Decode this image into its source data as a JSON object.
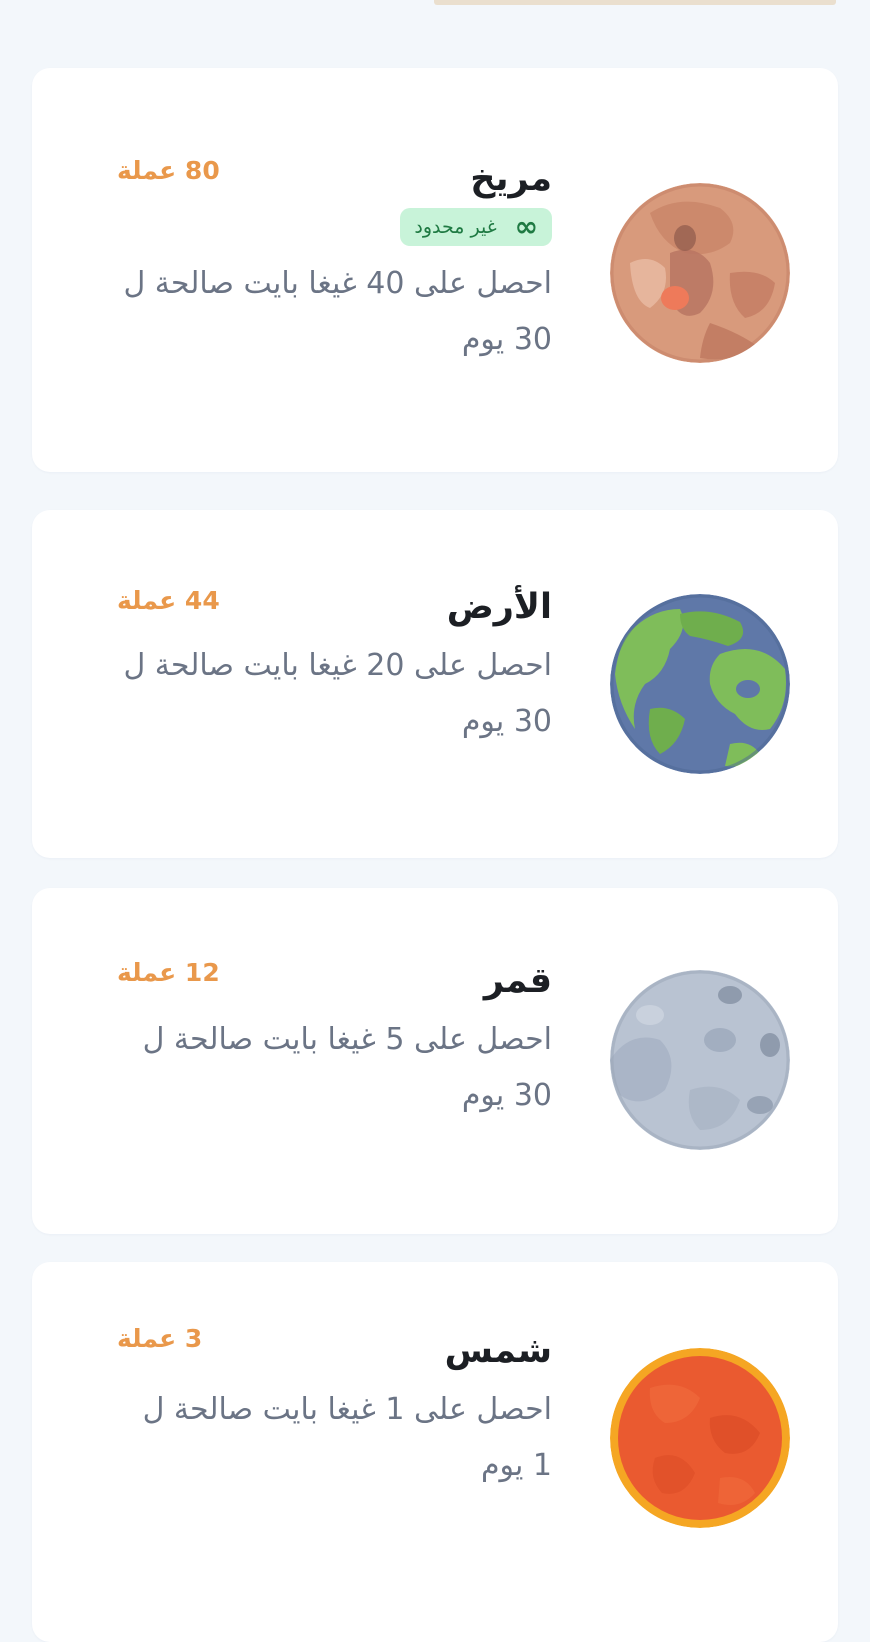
{
  "plans": [
    {
      "name": "مريخ",
      "price": "80 عملة",
      "badge": {
        "icon": "infinity-icon",
        "symbol": "∞",
        "label": "غير محدود"
      },
      "description": "احصل على 40 غيغا بايت صالحة ل 30 يوم",
      "planet_icon": "mars-planet-icon"
    },
    {
      "name": "الأرض",
      "price": "44 عملة",
      "description": "احصل على 20 غيغا بايت صالحة ل 30 يوم",
      "planet_icon": "earth-planet-icon"
    },
    {
      "name": "قمر",
      "price": "12 عملة",
      "description": "احصل على 5 غيغا بايت صالحة ل 30 يوم",
      "planet_icon": "moon-planet-icon"
    },
    {
      "name": "شمس",
      "price": "3 عملة",
      "description": "احصل على 1 غيغا بايت صالحة ل 1 يوم",
      "planet_icon": "sun-planet-icon"
    }
  ],
  "colors": {
    "background": "#f3f7fb",
    "card": "#ffffff",
    "title": "#1c1f24",
    "description": "#6b7485",
    "price": "#e9984b",
    "badge_bg": "#c8f3d9",
    "badge_text": "#1f7a43"
  }
}
